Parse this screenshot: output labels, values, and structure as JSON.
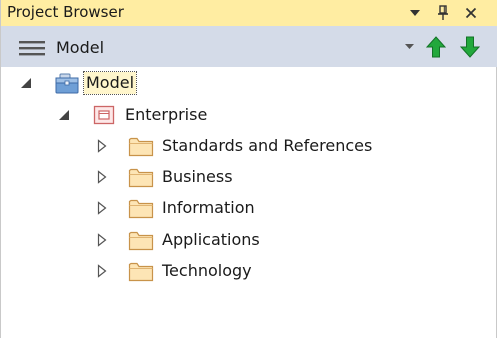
{
  "window": {
    "title": "Project Browser"
  },
  "toolbar": {
    "current_package": "Model"
  },
  "tree": {
    "root": {
      "label": "Model",
      "expanded": true,
      "icon": "model-root-icon",
      "selected": true
    },
    "enterprise": {
      "label": "Enterprise",
      "expanded": true,
      "icon": "package-diagram-icon"
    },
    "children": [
      {
        "label": "Standards and References",
        "icon": "folder-icon",
        "expanded": false
      },
      {
        "label": "Business",
        "icon": "folder-icon",
        "expanded": false
      },
      {
        "label": "Information",
        "icon": "folder-icon",
        "expanded": false
      },
      {
        "label": "Applications",
        "icon": "folder-icon",
        "expanded": false
      },
      {
        "label": "Technology",
        "icon": "folder-icon",
        "expanded": false
      }
    ]
  },
  "colors": {
    "title_bar": "#ffeda2",
    "toolbar": "#d4dbe8",
    "arrow_green": "#1fa23a",
    "folder_fill": "#fde5b5",
    "folder_stroke": "#c8934a"
  }
}
